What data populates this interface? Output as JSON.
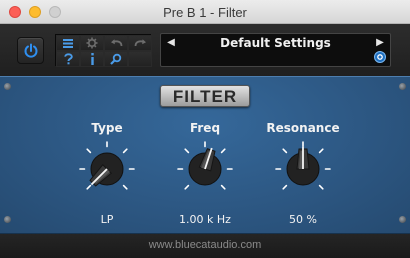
{
  "window": {
    "title": "Pre B 1 - Filter"
  },
  "toolbar": {
    "power_icon": "power-icon",
    "buttons": [
      {
        "icon": "menu-icon",
        "color": "#4a9be8"
      },
      {
        "icon": "gear-icon",
        "color": "#6d6d6d"
      },
      {
        "icon": "undo-icon",
        "color": "#6d6d6d"
      },
      {
        "icon": "redo-icon",
        "color": "#6d6d6d"
      },
      {
        "icon": "help-icon",
        "color": "#4a9be8"
      },
      {
        "icon": "info-icon",
        "color": "#4a9be8"
      },
      {
        "icon": "search-icon",
        "color": "#4a9be8"
      },
      {
        "icon": "empty",
        "color": "#2a2a2a"
      }
    ],
    "preset": {
      "prev_label": "◀",
      "next_label": "▶",
      "name": "Default Settings"
    }
  },
  "panel": {
    "title": "FILTER",
    "knobs": [
      {
        "label": "Type",
        "value": "LP"
      },
      {
        "label": "Freq",
        "value": "1.00 k Hz"
      },
      {
        "label": "Resonance",
        "value": "50 %"
      }
    ]
  },
  "footer": {
    "url": "www.bluecataudio.com"
  },
  "colors": {
    "accent": "#2f8ff0",
    "panel": "#2e5a86"
  }
}
